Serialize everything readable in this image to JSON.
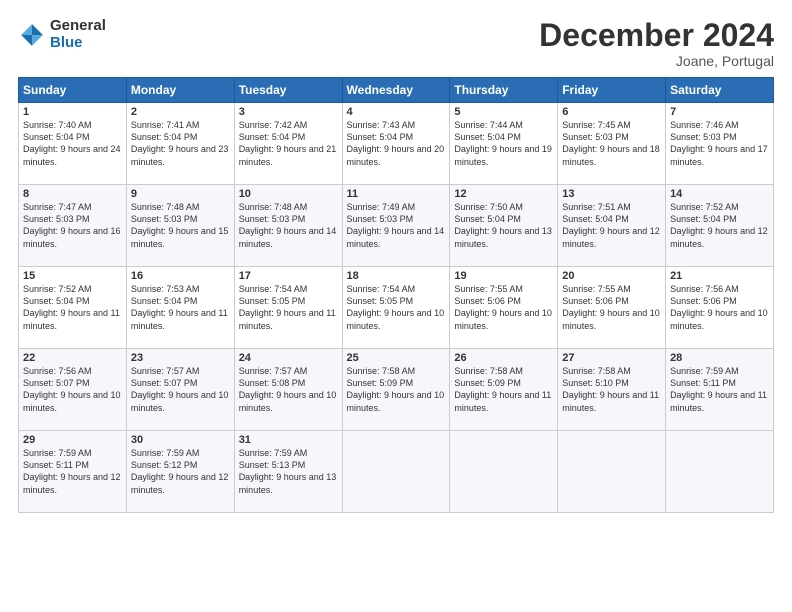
{
  "logo": {
    "general": "General",
    "blue": "Blue"
  },
  "header": {
    "title": "December 2024",
    "subtitle": "Joane, Portugal"
  },
  "weekdays": [
    "Sunday",
    "Monday",
    "Tuesday",
    "Wednesday",
    "Thursday",
    "Friday",
    "Saturday"
  ],
  "weeks": [
    [
      {
        "day": "1",
        "sunrise": "Sunrise: 7:40 AM",
        "sunset": "Sunset: 5:04 PM",
        "daylight": "Daylight: 9 hours and 24 minutes."
      },
      {
        "day": "2",
        "sunrise": "Sunrise: 7:41 AM",
        "sunset": "Sunset: 5:04 PM",
        "daylight": "Daylight: 9 hours and 23 minutes."
      },
      {
        "day": "3",
        "sunrise": "Sunrise: 7:42 AM",
        "sunset": "Sunset: 5:04 PM",
        "daylight": "Daylight: 9 hours and 21 minutes."
      },
      {
        "day": "4",
        "sunrise": "Sunrise: 7:43 AM",
        "sunset": "Sunset: 5:04 PM",
        "daylight": "Daylight: 9 hours and 20 minutes."
      },
      {
        "day": "5",
        "sunrise": "Sunrise: 7:44 AM",
        "sunset": "Sunset: 5:04 PM",
        "daylight": "Daylight: 9 hours and 19 minutes."
      },
      {
        "day": "6",
        "sunrise": "Sunrise: 7:45 AM",
        "sunset": "Sunset: 5:03 PM",
        "daylight": "Daylight: 9 hours and 18 minutes."
      },
      {
        "day": "7",
        "sunrise": "Sunrise: 7:46 AM",
        "sunset": "Sunset: 5:03 PM",
        "daylight": "Daylight: 9 hours and 17 minutes."
      }
    ],
    [
      {
        "day": "8",
        "sunrise": "Sunrise: 7:47 AM",
        "sunset": "Sunset: 5:03 PM",
        "daylight": "Daylight: 9 hours and 16 minutes."
      },
      {
        "day": "9",
        "sunrise": "Sunrise: 7:48 AM",
        "sunset": "Sunset: 5:03 PM",
        "daylight": "Daylight: 9 hours and 15 minutes."
      },
      {
        "day": "10",
        "sunrise": "Sunrise: 7:48 AM",
        "sunset": "Sunset: 5:03 PM",
        "daylight": "Daylight: 9 hours and 14 minutes."
      },
      {
        "day": "11",
        "sunrise": "Sunrise: 7:49 AM",
        "sunset": "Sunset: 5:03 PM",
        "daylight": "Daylight: 9 hours and 14 minutes."
      },
      {
        "day": "12",
        "sunrise": "Sunrise: 7:50 AM",
        "sunset": "Sunset: 5:04 PM",
        "daylight": "Daylight: 9 hours and 13 minutes."
      },
      {
        "day": "13",
        "sunrise": "Sunrise: 7:51 AM",
        "sunset": "Sunset: 5:04 PM",
        "daylight": "Daylight: 9 hours and 12 minutes."
      },
      {
        "day": "14",
        "sunrise": "Sunrise: 7:52 AM",
        "sunset": "Sunset: 5:04 PM",
        "daylight": "Daylight: 9 hours and 12 minutes."
      }
    ],
    [
      {
        "day": "15",
        "sunrise": "Sunrise: 7:52 AM",
        "sunset": "Sunset: 5:04 PM",
        "daylight": "Daylight: 9 hours and 11 minutes."
      },
      {
        "day": "16",
        "sunrise": "Sunrise: 7:53 AM",
        "sunset": "Sunset: 5:04 PM",
        "daylight": "Daylight: 9 hours and 11 minutes."
      },
      {
        "day": "17",
        "sunrise": "Sunrise: 7:54 AM",
        "sunset": "Sunset: 5:05 PM",
        "daylight": "Daylight: 9 hours and 11 minutes."
      },
      {
        "day": "18",
        "sunrise": "Sunrise: 7:54 AM",
        "sunset": "Sunset: 5:05 PM",
        "daylight": "Daylight: 9 hours and 10 minutes."
      },
      {
        "day": "19",
        "sunrise": "Sunrise: 7:55 AM",
        "sunset": "Sunset: 5:06 PM",
        "daylight": "Daylight: 9 hours and 10 minutes."
      },
      {
        "day": "20",
        "sunrise": "Sunrise: 7:55 AM",
        "sunset": "Sunset: 5:06 PM",
        "daylight": "Daylight: 9 hours and 10 minutes."
      },
      {
        "day": "21",
        "sunrise": "Sunrise: 7:56 AM",
        "sunset": "Sunset: 5:06 PM",
        "daylight": "Daylight: 9 hours and 10 minutes."
      }
    ],
    [
      {
        "day": "22",
        "sunrise": "Sunrise: 7:56 AM",
        "sunset": "Sunset: 5:07 PM",
        "daylight": "Daylight: 9 hours and 10 minutes."
      },
      {
        "day": "23",
        "sunrise": "Sunrise: 7:57 AM",
        "sunset": "Sunset: 5:07 PM",
        "daylight": "Daylight: 9 hours and 10 minutes."
      },
      {
        "day": "24",
        "sunrise": "Sunrise: 7:57 AM",
        "sunset": "Sunset: 5:08 PM",
        "daylight": "Daylight: 9 hours and 10 minutes."
      },
      {
        "day": "25",
        "sunrise": "Sunrise: 7:58 AM",
        "sunset": "Sunset: 5:09 PM",
        "daylight": "Daylight: 9 hours and 10 minutes."
      },
      {
        "day": "26",
        "sunrise": "Sunrise: 7:58 AM",
        "sunset": "Sunset: 5:09 PM",
        "daylight": "Daylight: 9 hours and 11 minutes."
      },
      {
        "day": "27",
        "sunrise": "Sunrise: 7:58 AM",
        "sunset": "Sunset: 5:10 PM",
        "daylight": "Daylight: 9 hours and 11 minutes."
      },
      {
        "day": "28",
        "sunrise": "Sunrise: 7:59 AM",
        "sunset": "Sunset: 5:11 PM",
        "daylight": "Daylight: 9 hours and 11 minutes."
      }
    ],
    [
      {
        "day": "29",
        "sunrise": "Sunrise: 7:59 AM",
        "sunset": "Sunset: 5:11 PM",
        "daylight": "Daylight: 9 hours and 12 minutes."
      },
      {
        "day": "30",
        "sunrise": "Sunrise: 7:59 AM",
        "sunset": "Sunset: 5:12 PM",
        "daylight": "Daylight: 9 hours and 12 minutes."
      },
      {
        "day": "31",
        "sunrise": "Sunrise: 7:59 AM",
        "sunset": "Sunset: 5:13 PM",
        "daylight": "Daylight: 9 hours and 13 minutes."
      },
      null,
      null,
      null,
      null
    ]
  ]
}
